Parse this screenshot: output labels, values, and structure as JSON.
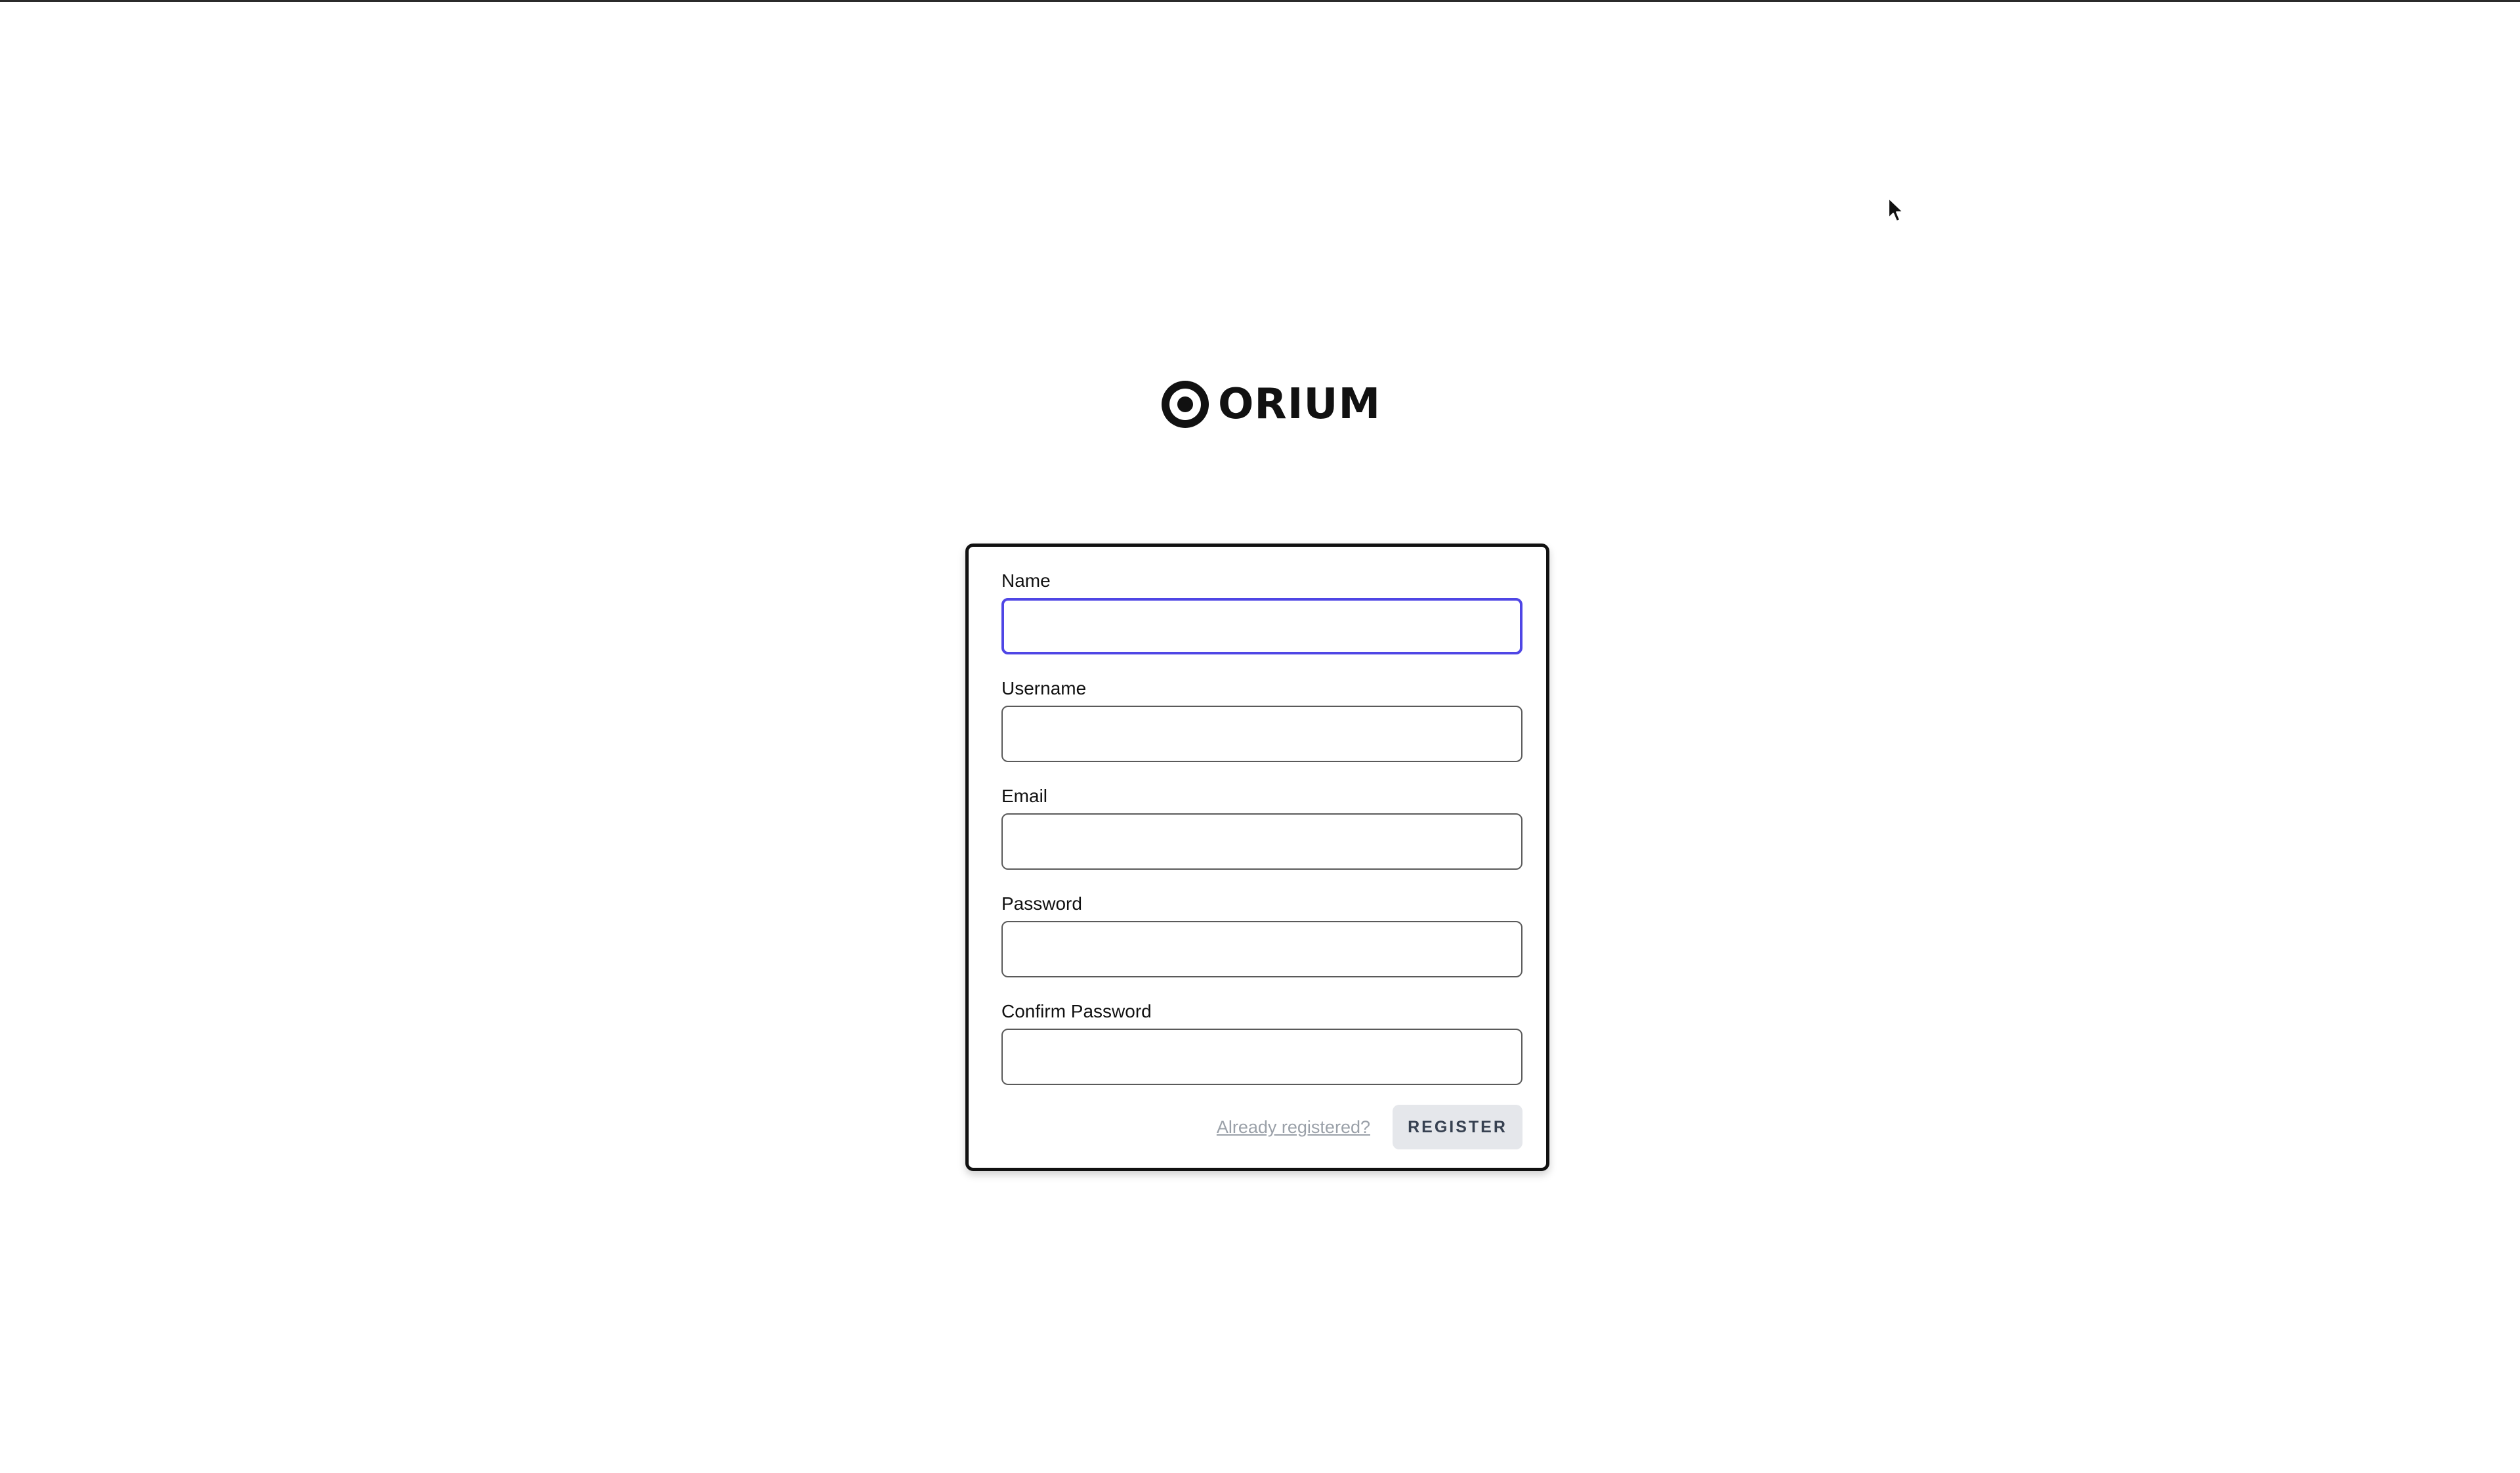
{
  "brand": {
    "name": "ORIUM",
    "icon": "orium-logo-icon"
  },
  "form": {
    "fields": [
      {
        "label": "Name",
        "value": "",
        "type": "text"
      },
      {
        "label": "Username",
        "value": "",
        "type": "text"
      },
      {
        "label": "Email",
        "value": "",
        "type": "email"
      },
      {
        "label": "Password",
        "value": "",
        "type": "password"
      },
      {
        "label": "Confirm Password",
        "value": "",
        "type": "password"
      }
    ],
    "login_link": "Already registered?",
    "submit_label": "REGISTER"
  },
  "colors": {
    "focus_ring": "#4f46e5",
    "button_bg": "#e5e7eb",
    "link": "#9aa0a8"
  }
}
